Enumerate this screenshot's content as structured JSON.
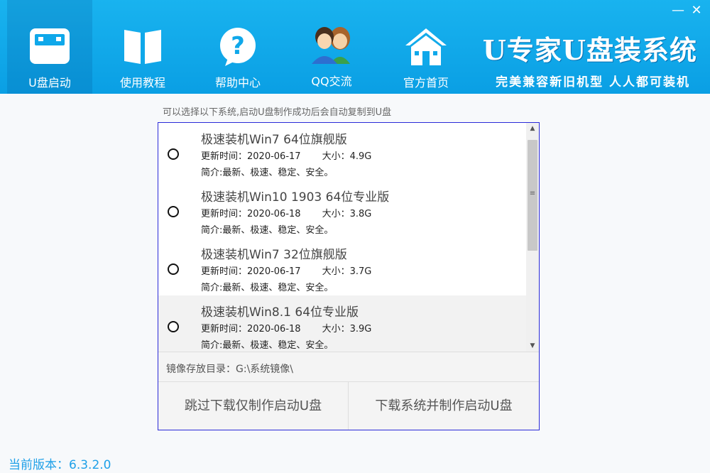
{
  "window": {
    "minimize_label": "—",
    "close_label": "✕"
  },
  "nav": [
    {
      "label": "U盘启动",
      "icon": "usb-drive-icon"
    },
    {
      "label": "使用教程",
      "icon": "book-icon"
    },
    {
      "label": "帮助中心",
      "icon": "help-bubble-icon"
    },
    {
      "label": "QQ交流",
      "icon": "people-icon"
    },
    {
      "label": "官方首页",
      "icon": "home-icon"
    }
  ],
  "brand": {
    "title": "U专家U盘装系统",
    "slogan": "完美兼容新旧机型  人人都可装机"
  },
  "hint": "可以选择以下系统,启动U盘制作成功后会自动复制到U盘",
  "systems": [
    {
      "title": "极速装机Win7 64位旗舰版",
      "updated": "更新时间：2020-06-17",
      "size": "大小：4.9G",
      "desc": "简介:最新、极速、稳定、安全。"
    },
    {
      "title": "极速装机Win10 1903 64位专业版",
      "updated": "更新时间：2020-06-18",
      "size": "大小：3.8G",
      "desc": "简介:最新、极速、稳定、安全。"
    },
    {
      "title": "极速装机Win7 32位旗舰版",
      "updated": "更新时间：2020-06-17",
      "size": "大小：3.7G",
      "desc": "简介:最新、极速、稳定、安全。"
    },
    {
      "title": "极速装机Win8.1 64位专业版",
      "updated": "更新时间：2020-06-18",
      "size": "大小：3.9G",
      "desc": "简介:最新、极速、稳定、安全。"
    }
  ],
  "image_dir": "镜像存放目录：G:\\系统镜像\\",
  "buttons": {
    "skip": "跳过下载仅制作启动U盘",
    "download": "下载系统并制作启动U盘"
  },
  "version": "当前版本：6.3.2.0",
  "colors": {
    "header": "#0fa8ea",
    "accent": "#1ea0e8",
    "panel_border": "#2a2ad8"
  }
}
